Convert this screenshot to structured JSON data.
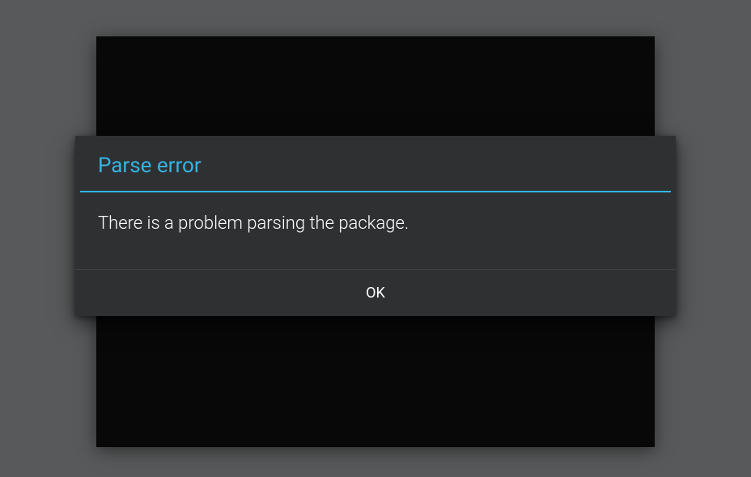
{
  "dialog": {
    "title": "Parse error",
    "message": "There is a problem parsing the package.",
    "ok_label": "OK"
  },
  "colors": {
    "accent": "#33b5e5",
    "dialog_bg": "#2f3032",
    "page_bg": "#57595a",
    "backdrop_bg": "#080808"
  }
}
